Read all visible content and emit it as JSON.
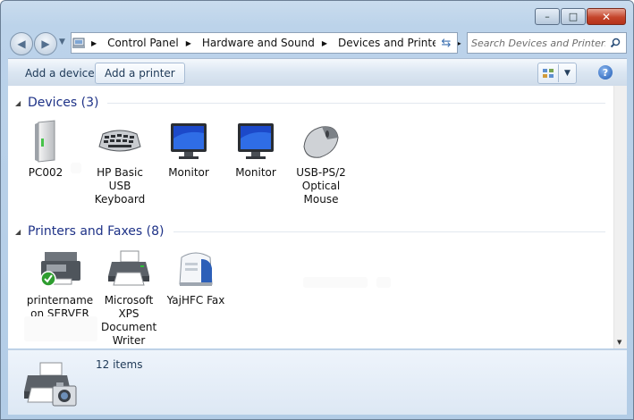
{
  "window": {
    "minimize_glyph": "–",
    "maximize_glyph": "□",
    "close_glyph": "✕"
  },
  "address_bar": {
    "breadcrumbs": [
      {
        "label": "Control Panel"
      },
      {
        "label": "Hardware and Sound"
      },
      {
        "label": "Devices and Printers"
      }
    ]
  },
  "search": {
    "placeholder": "Search Devices and Printers"
  },
  "toolbar": {
    "add_device_label": "Add a device",
    "add_printer_label": "Add a printer",
    "help_glyph": "?"
  },
  "groups": {
    "devices": {
      "title": "Devices (3)",
      "items": [
        {
          "label": "PC002",
          "icon": "pc-tower-icon"
        },
        {
          "label": "HP Basic USB Keyboard",
          "icon": "keyboard-icon"
        },
        {
          "label": "Monitor",
          "icon": "monitor-icon"
        },
        {
          "label": "Monitor",
          "icon": "monitor-icon"
        },
        {
          "label": "USB-PS/2 Optical Mouse",
          "icon": "mouse-icon"
        }
      ]
    },
    "printers": {
      "title": "Printers and Faxes (8)",
      "items": [
        {
          "label": "printername on SERVER",
          "icon": "network-printer-default-icon"
        },
        {
          "label": "Microsoft XPS Document Writer",
          "icon": "printer-icon"
        },
        {
          "label": "YajHFC Fax",
          "icon": "fax-icon"
        }
      ]
    }
  },
  "details": {
    "item_count": "12 items",
    "icon": "devices-and-printers-icon"
  }
}
